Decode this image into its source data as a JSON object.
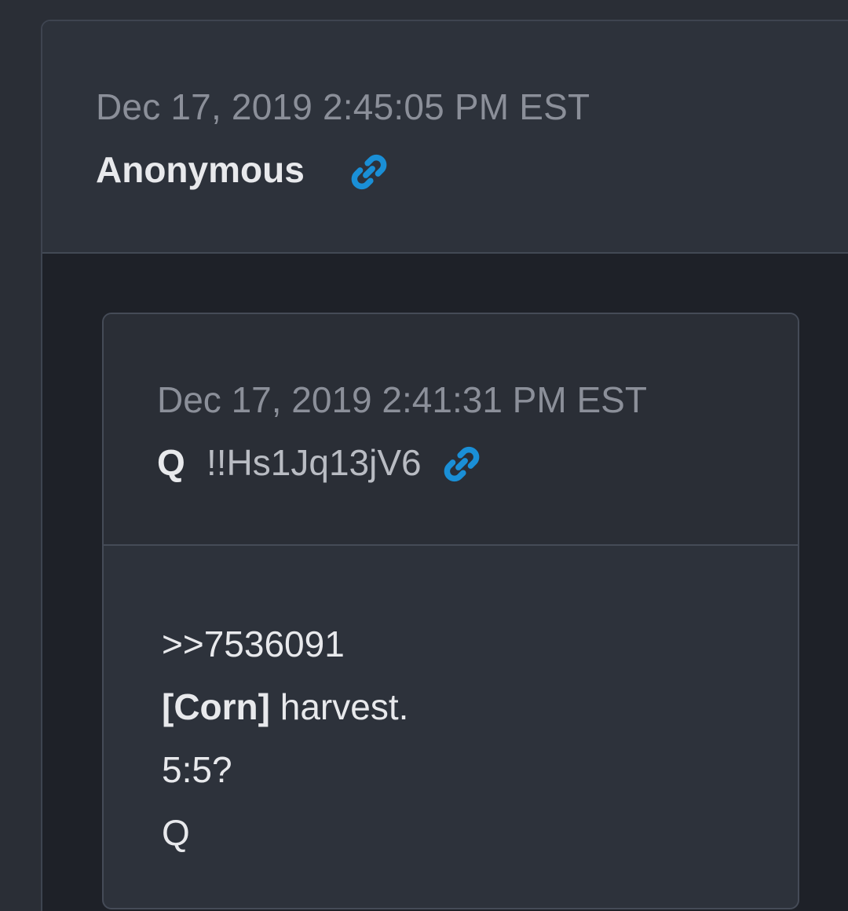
{
  "outer_post": {
    "timestamp": "Dec 17, 2019 2:45:05 PM EST",
    "author": "Anonymous",
    "link_icon": "link-icon",
    "link_color": "#1a8fd6"
  },
  "quoted_post": {
    "timestamp": "Dec 17, 2019 2:41:31 PM EST",
    "author": "Q",
    "tripcode": "!!Hs1Jq13jV6",
    "link_icon": "link-icon",
    "link_color": "#1a8fd6",
    "body": {
      "reply_ref": ">>7536091",
      "line2_bold": "[Corn]",
      "line2_rest": " harvest.",
      "line3": "5:5?",
      "line4": "Q"
    }
  }
}
